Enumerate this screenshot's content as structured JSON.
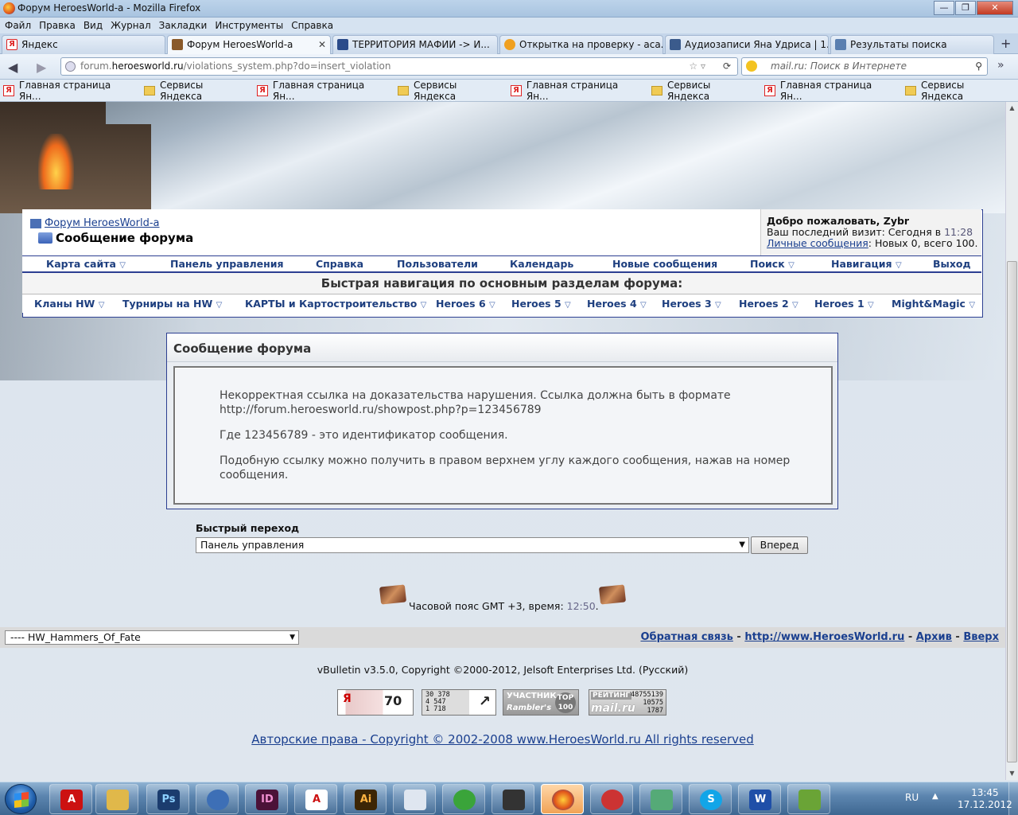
{
  "window": {
    "title": "Форум HeroesWorld-а - Mozilla Firefox"
  },
  "menu": [
    "Файл",
    "Правка",
    "Вид",
    "Журнал",
    "Закладки",
    "Инструменты",
    "Справка"
  ],
  "tabs": [
    {
      "label": "Яндекс",
      "active": false
    },
    {
      "label": "Форум HeroesWorld-а",
      "active": true
    },
    {
      "label": "ТЕРРИТОРИЯ МАФИИ -> И...",
      "active": false
    },
    {
      "label": "Открытка на проверку - аса...",
      "active": false
    },
    {
      "label": "Аудиозаписи Яна Удриса | 1...",
      "active": false
    },
    {
      "label": "Результаты поиска",
      "active": false
    }
  ],
  "nav": {
    "url_prefix": "forum.",
    "url_domain": "heroesworld.ru",
    "url_rest": "/violations_system.php?do=insert_violation",
    "search_placeholder": "mail.ru: Поиск в Интернете"
  },
  "bookmarks": [
    {
      "label": "Главная страница Ян...",
      "icon": "yandex-icon"
    },
    {
      "label": "Сервисы Яндекса",
      "icon": "folder-icon"
    },
    {
      "label": "Главная страница Ян...",
      "icon": "yandex-icon"
    },
    {
      "label": "Сервисы Яндекса",
      "icon": "folder-icon"
    },
    {
      "label": "Главная страница Ян...",
      "icon": "yandex-icon"
    },
    {
      "label": "Сервисы Яндекса",
      "icon": "folder-icon"
    },
    {
      "label": "Главная страница Ян...",
      "icon": "yandex-icon"
    },
    {
      "label": "Сервисы Яндекса",
      "icon": "folder-icon"
    }
  ],
  "forum": {
    "home_link": "Форум HeroesWorld-а",
    "current_page": "Сообщение форума",
    "welcome": {
      "greeting": "Добро пожаловать, Zybr",
      "last_visit_label": "Ваш последний визит: Сегодня в ",
      "last_visit_time": "11:28",
      "pm_link": "Личные сообщения",
      "pm_text": ": Новых 0, всего 100."
    },
    "top_menu": [
      "Карта сайта",
      "Панель управления",
      "Справка",
      "Пользователи",
      "Календарь",
      "Новые сообщения",
      "Поиск",
      "Навигация",
      "Выход"
    ],
    "quick_nav_title": "Быстрая навигация по основным разделам форума:",
    "sections": [
      "Кланы HW",
      "Турниры на HW",
      "КАРТЫ и Картостроительство",
      "Heroes 6",
      "Heroes 5",
      "Heroes 4",
      "Heroes 3",
      "Heroes 2",
      "Heroes 1",
      "Might&Magic"
    ]
  },
  "message": {
    "title": "Сообщение форума",
    "p1": "Некорректная ссылка на доказательства нарушения. Ссылка должна быть в формате http://forum.heroesworld.ru/showpost.php?p=123456789",
    "p2": "Где 123456789 - это идентификатор сообщения.",
    "p3": "Подобную ссылку можно получить в правом верхнем углу каждого сообщения, нажав на номер сообщения."
  },
  "quick_jump": {
    "label": "Быстрый переход",
    "selected": "Панель управления",
    "button": "Вперед"
  },
  "timezone": {
    "text": "Часовой пояс GMT +3, время: ",
    "time": "12:50",
    "end": "."
  },
  "footer": {
    "style_selected": "---- HW_Hammers_Of_Fate",
    "links": [
      "Обратная связь",
      "http://www.HeroesWorld.ru",
      "Архив",
      "Вверх"
    ],
    "copyright": "vBulletin v3.5.0, Copyright ©2000-2012, Jelsoft Enterprises Ltd. (Русский)",
    "authors": "Авторские права - Copyright © 2002-2008 www.HeroesWorld.ru All rights reserved"
  },
  "counters": {
    "yandex_value": "70",
    "li_lines": [
      "30 378",
      "4 547",
      "1 718"
    ],
    "rambler_a": "УЧАСТНИК",
    "rambler_b": "Rambler's",
    "rambler_top": "TOP 100",
    "mail_a": "РЕЙТИНГ",
    "mail_b": "mail.ru",
    "mail_lines": [
      "48755139",
      "10575",
      "1787"
    ]
  },
  "taskbar": {
    "apps": [
      "explorer",
      "acrobat",
      "folder",
      "photoshop",
      "thunderbird",
      "indesign",
      "pdf",
      "illustrator",
      "paint",
      "corel",
      "monitor",
      "firefox",
      "opera",
      "winamp",
      "skype",
      "word",
      "torrent"
    ],
    "lang": "RU",
    "time": "13:45",
    "date": "17.12.2012"
  },
  "colors": {
    "link": "#1a3f8f",
    "border": "#2c3f91",
    "accent_time": "#557"
  }
}
